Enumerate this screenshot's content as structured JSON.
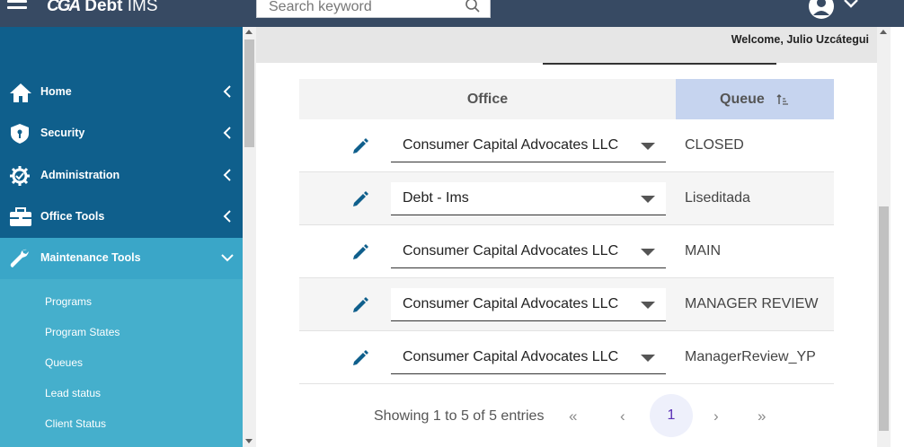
{
  "header": {
    "logo_mark": "CGA",
    "app_name": "Debt",
    "app_suffix": "IMS",
    "search_placeholder": "Search keyword"
  },
  "welcome": "Welcome, Julio Uzcátegui",
  "sidebar": {
    "items": [
      {
        "label": "Home",
        "icon": "home-icon"
      },
      {
        "label": "Security",
        "icon": "shield-icon"
      },
      {
        "label": "Administration",
        "icon": "gear-icon"
      },
      {
        "label": "Office Tools",
        "icon": "briefcase-icon"
      },
      {
        "label": "Maintenance Tools",
        "icon": "wrench-icon",
        "active": true
      }
    ],
    "subitems": [
      "Programs",
      "Program States",
      "Queues",
      "Lead status",
      "Client Status"
    ]
  },
  "table": {
    "columns": {
      "office": "Office",
      "queue": "Queue"
    },
    "rows": [
      {
        "office": "Consumer Capital Advocates LLC",
        "queue": "CLOSED"
      },
      {
        "office": "Debt - Ims",
        "queue": "Liseditada"
      },
      {
        "office": "Consumer Capital Advocates LLC",
        "queue": "MAIN"
      },
      {
        "office": "Consumer Capital Advocates LLC",
        "queue": "MANAGER REVIEW"
      },
      {
        "office": "Consumer Capital Advocates LLC",
        "queue": "ManagerReview_YP"
      }
    ]
  },
  "pager": {
    "info": "Showing 1 to 5 of 5 entries",
    "first": "«",
    "prev": "‹",
    "current": "1",
    "next": "›",
    "last": "»"
  },
  "colors": {
    "topbar": "#374a63",
    "sidebar": "#0f5f8c",
    "sidebar_active": "#3aa6c8",
    "submenu": "#45afcc",
    "queue_header": "#c6d4ef",
    "edit_icon": "#0f5f8c"
  }
}
